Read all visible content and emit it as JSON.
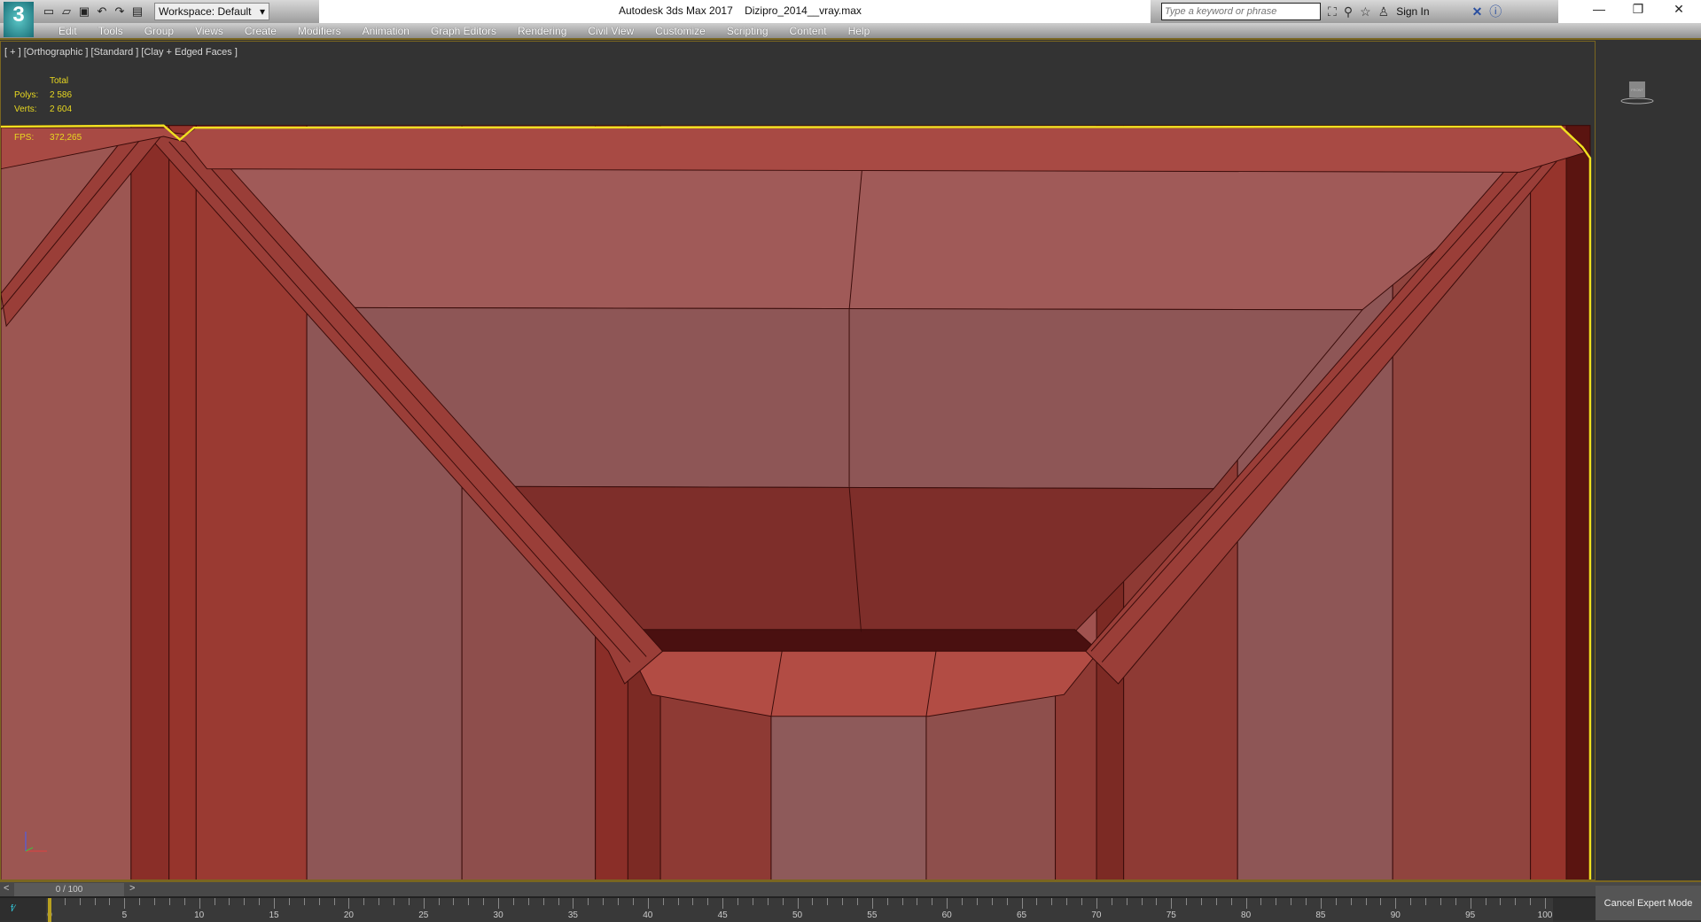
{
  "app": {
    "logo": "3",
    "title": "Autodesk 3ds Max 2017    Dizipro_2014__vray.max"
  },
  "toolbar": {
    "workspace": "Workspace: Default",
    "icons": [
      "new-file-icon",
      "open-folder-icon",
      "save-icon",
      "undo-icon",
      "redo-icon",
      "project-icon"
    ]
  },
  "infocenter": {
    "search_placeholder": "Type a keyword or phrase",
    "sign_in": "Sign In"
  },
  "menu": [
    "Edit",
    "Tools",
    "Group",
    "Views",
    "Create",
    "Modifiers",
    "Animation",
    "Graph Editors",
    "Rendering",
    "Civil View",
    "Customize",
    "Scripting",
    "Content",
    "Help"
  ],
  "viewport": {
    "label": "[ + ] [Orthographic ] [Standard ] [Clay + Edged Faces ]",
    "stats": {
      "total_label": "Total",
      "polys_label": "Polys:",
      "polys": "2 586",
      "verts_label": "Verts:",
      "verts": "2 604",
      "fps_label": "FPS:",
      "fps": "372,265"
    },
    "viewcube_label": "FRONT",
    "selection_color": "#f0e020",
    "object_color": "#a0524f"
  },
  "timeslider": {
    "value": "0 / 100",
    "prev": "<",
    "next": ">"
  },
  "timeline": {
    "ticks": [
      "0",
      "5",
      "10",
      "15",
      "20",
      "25",
      "30",
      "35",
      "40",
      "45",
      "50",
      "55",
      "60",
      "65",
      "70",
      "75",
      "80",
      "85",
      "90",
      "95",
      "100"
    ],
    "current_frame": 0
  },
  "expert": {
    "cancel_label": "Cancel Expert Mode"
  }
}
